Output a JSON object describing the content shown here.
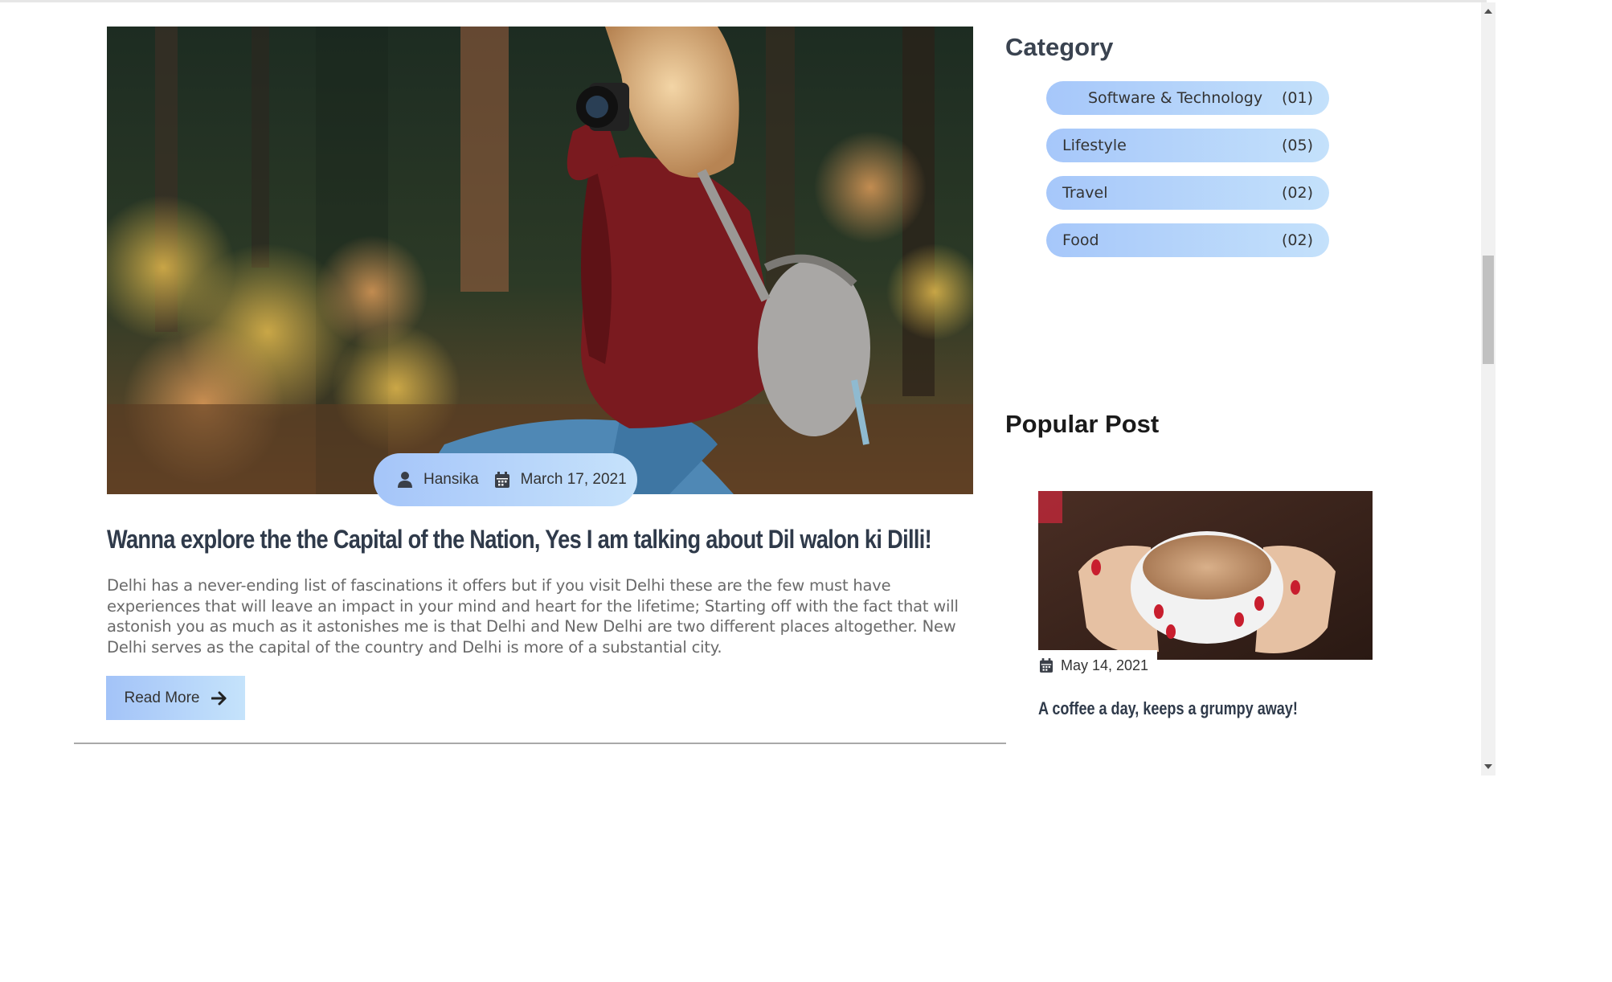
{
  "post": {
    "author": "Hansika",
    "date": "March 17, 2021",
    "title": "Wanna explore the the Capital of the Nation, Yes I am talking about Dil walon ki Dilli!",
    "excerpt": "Delhi has a never-ending list of fascinations it offers but if you visit Delhi these are the few must have experiences that will leave an impact in your mind and heart for the lifetime; Starting off with the fact that will astonish you as much as it astonishes me is that Delhi and New Delhi are two different places altogether. New Delhi serves as the capital of the country and Delhi is more of a substantial city.",
    "read_more": "Read More"
  },
  "sidebar": {
    "category_heading": "Category",
    "categories": [
      {
        "name": "Software & Technology",
        "count": "(01)"
      },
      {
        "name": "Lifestyle",
        "count": "(05)"
      },
      {
        "name": "Travel",
        "count": "(02)"
      },
      {
        "name": "Food",
        "count": "(02)"
      }
    ],
    "popular_heading": "Popular Post",
    "popular": {
      "date": "May 14, 2021",
      "title": "A coffee a day, keeps a grumpy away!"
    }
  },
  "icons": {
    "author": "user-icon",
    "date": "calendar-icon",
    "read_more": "arrow-right-icon",
    "scroll_up": "triangle-up-icon",
    "scroll_down": "triangle-down-icon"
  },
  "colors": {
    "pill_gradient_start": "#a6c7fa",
    "pill_gradient_end": "#c4e1fb",
    "title_color": "#2f3a4a",
    "excerpt_color": "#6a6a6a"
  }
}
